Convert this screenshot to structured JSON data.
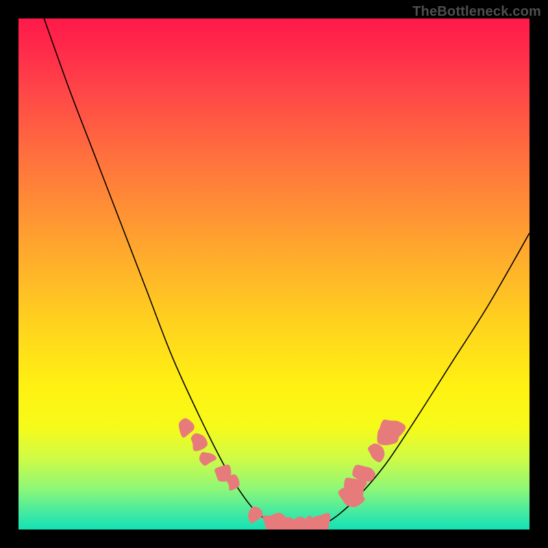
{
  "watermark": "TheBottleneck.com",
  "chart_data": {
    "type": "line",
    "title": "",
    "xlabel": "",
    "ylabel": "",
    "xlim": [
      0,
      100
    ],
    "ylim": [
      0,
      100
    ],
    "grid": false,
    "legend": false,
    "series": [
      {
        "name": "curve",
        "x": [
          5,
          10,
          15,
          20,
          25,
          30,
          35,
          40,
          43,
          46,
          49,
          51,
          53,
          55,
          57,
          60,
          63,
          67,
          72,
          78,
          85,
          92,
          100
        ],
        "y": [
          100,
          86,
          73,
          60,
          47,
          34,
          23,
          13,
          8,
          4,
          1.5,
          0.6,
          0.3,
          0.2,
          0.3,
          1.2,
          3.2,
          7,
          13,
          22,
          33,
          44,
          58
        ]
      }
    ],
    "markers": [
      {
        "name": "blob-left-1",
        "x": 33,
        "y": 20
      },
      {
        "name": "blob-left-2",
        "x": 35,
        "y": 17
      },
      {
        "name": "blob-left-3",
        "x": 37,
        "y": 14
      },
      {
        "name": "blob-left-4",
        "x": 40,
        "y": 11
      },
      {
        "name": "blob-left-5",
        "x": 42,
        "y": 9
      },
      {
        "name": "blob-bottom-1",
        "x": 46,
        "y": 3
      },
      {
        "name": "blob-bottom-2",
        "x": 49,
        "y": 1.5
      },
      {
        "name": "blob-bottom-3",
        "x": 51,
        "y": 0.8
      },
      {
        "name": "blob-bottom-4",
        "x": 53,
        "y": 0.4
      },
      {
        "name": "blob-bottom-5",
        "x": 55,
        "y": 0.3
      },
      {
        "name": "blob-bottom-6",
        "x": 57,
        "y": 0.5
      },
      {
        "name": "blob-bottom-7",
        "x": 59,
        "y": 1.2
      },
      {
        "name": "blob-right-1",
        "x": 65,
        "y": 6
      },
      {
        "name": "blob-right-2",
        "x": 66,
        "y": 8
      },
      {
        "name": "blob-right-3",
        "x": 68,
        "y": 11
      },
      {
        "name": "blob-right-4",
        "x": 70,
        "y": 15
      },
      {
        "name": "blob-right-5",
        "x": 72,
        "y": 18
      },
      {
        "name": "blob-right-6",
        "x": 73,
        "y": 20
      }
    ]
  }
}
